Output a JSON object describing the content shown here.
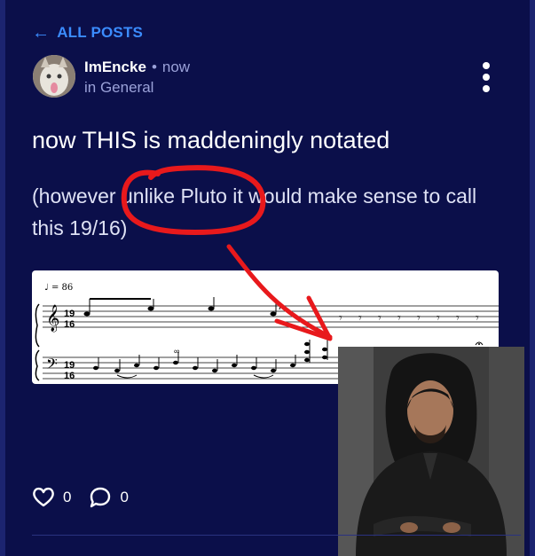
{
  "nav": {
    "back_label": "ALL POSTS",
    "back_icon": "arrow-left-icon"
  },
  "post": {
    "author": "ImEncke",
    "separator": "•",
    "time": "now",
    "category": "in General",
    "title": "now THIS is maddeningly notated",
    "body": "(however unlike Pluto it would make sense to call this 19/16)",
    "likes": "0",
    "comments": "0"
  },
  "score": {
    "tempo_text": "= 86",
    "time_signature": "19/16"
  },
  "colors": {
    "background": "#0b0f4a",
    "link": "#3b8cff",
    "muted": "#9aa1d8",
    "annotation_red": "#e8191c"
  }
}
